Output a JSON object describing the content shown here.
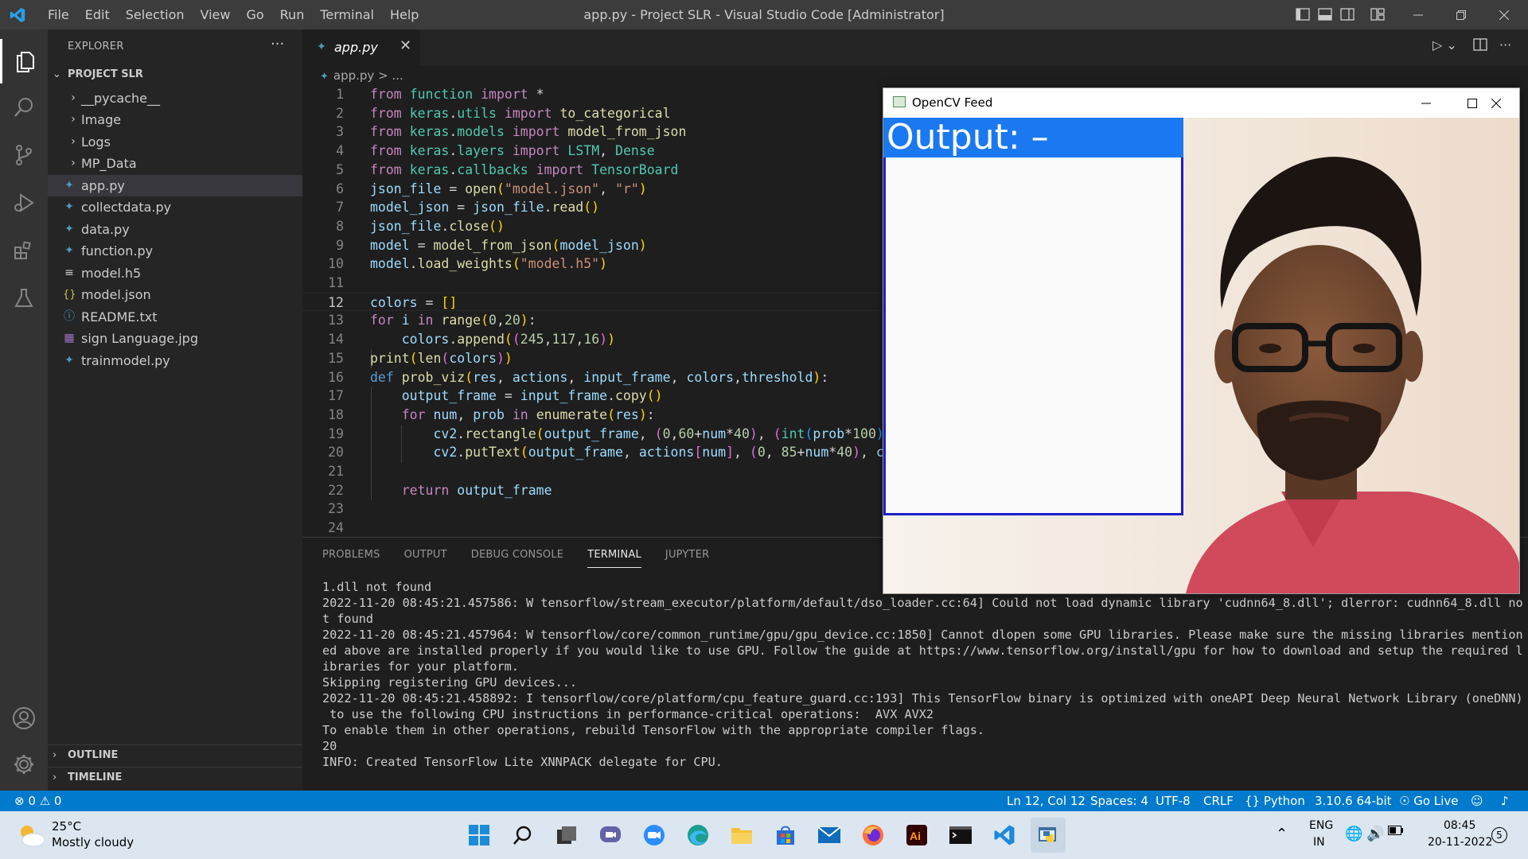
{
  "window": {
    "title": "app.py - Project SLR - Visual Studio Code [Administrator]",
    "menu": [
      "File",
      "Edit",
      "Selection",
      "View",
      "Go",
      "Run",
      "Terminal",
      "Help"
    ]
  },
  "sidebar": {
    "title": "EXPLORER",
    "dots": "···",
    "project": "PROJECT SLR",
    "items": [
      {
        "label": "__pycache__",
        "type": "folder"
      },
      {
        "label": "Image",
        "type": "folder"
      },
      {
        "label": "Logs",
        "type": "folder"
      },
      {
        "label": "MP_Data",
        "type": "folder"
      },
      {
        "label": "app.py",
        "type": "python",
        "selected": true
      },
      {
        "label": "collectdata.py",
        "type": "python"
      },
      {
        "label": "data.py",
        "type": "python"
      },
      {
        "label": "function.py",
        "type": "python"
      },
      {
        "label": "model.h5",
        "type": "file"
      },
      {
        "label": "model.json",
        "type": "json"
      },
      {
        "label": "README.txt",
        "type": "info"
      },
      {
        "label": "sign Language.jpg",
        "type": "image"
      },
      {
        "label": "trainmodel.py",
        "type": "python"
      }
    ],
    "outline": "OUTLINE",
    "timeline": "TIMELINE"
  },
  "editor": {
    "tab": "app.py",
    "breadcrumb_file": "app.py",
    "breadcrumb_rest": " > ...",
    "line_numbers": [
      "1",
      "2",
      "3",
      "4",
      "5",
      "6",
      "7",
      "8",
      "9",
      "10",
      "11",
      "12",
      "13",
      "14",
      "15",
      "16",
      "17",
      "18",
      "19",
      "20",
      "21",
      "22",
      "23",
      "24"
    ]
  },
  "panel": {
    "tabs": [
      "PROBLEMS",
      "OUTPUT",
      "DEBUG CONSOLE",
      "TERMINAL",
      "JUPYTER"
    ],
    "active_tab": "TERMINAL",
    "terminal_lines": [
      "1.dll not found",
      "2022-11-20 08:45:21.457586: W tensorflow/stream_executor/platform/default/dso_loader.cc:64] Could not load dynamic library 'cudnn64_8.dll'; dlerror: cudnn64_8.dll no",
      "t found",
      "2022-11-20 08:45:21.457964: W tensorflow/core/common_runtime/gpu/gpu_device.cc:1850] Cannot dlopen some GPU libraries. Please make sure the missing libraries mention",
      "ed above are installed properly if you would like to use GPU. Follow the guide at https://www.tensorflow.org/install/gpu for how to download and setup the required l",
      "ibraries for your platform.",
      "Skipping registering GPU devices...",
      "2022-11-20 08:45:21.458892: I tensorflow/core/platform/cpu_feature_guard.cc:193] This TensorFlow binary is optimized with oneAPI Deep Neural Network Library (oneDNN)",
      " to use the following CPU instructions in performance-critical operations:  AVX AVX2",
      "To enable them in other operations, rebuild TensorFlow with the appropriate compiler flags.",
      "20",
      "INFO: Created TensorFlow Lite XNNPACK delegate for CPU."
    ]
  },
  "statusbar": {
    "errors": "0",
    "warnings": "0",
    "position": "Ln 12, Col 12",
    "spaces": "Spaces: 4",
    "encoding": "UTF-8",
    "eol": "CRLF",
    "language": "Python",
    "interpreter": "3.10.6 64-bit",
    "golive": "Go Live"
  },
  "opencv": {
    "title": "OpenCV Feed",
    "output_text": "Output: –"
  },
  "taskbar": {
    "temperature": "25°C",
    "weather": "Mostly cloudy",
    "lang_top": "ENG",
    "lang_bottom": "IN",
    "time": "08:45",
    "date": "20-11-2022",
    "notifications": "5"
  },
  "colors": {
    "statusbar": "#007acc",
    "output_bar": "#1a79f1",
    "output_border": "#1d1dc8"
  }
}
